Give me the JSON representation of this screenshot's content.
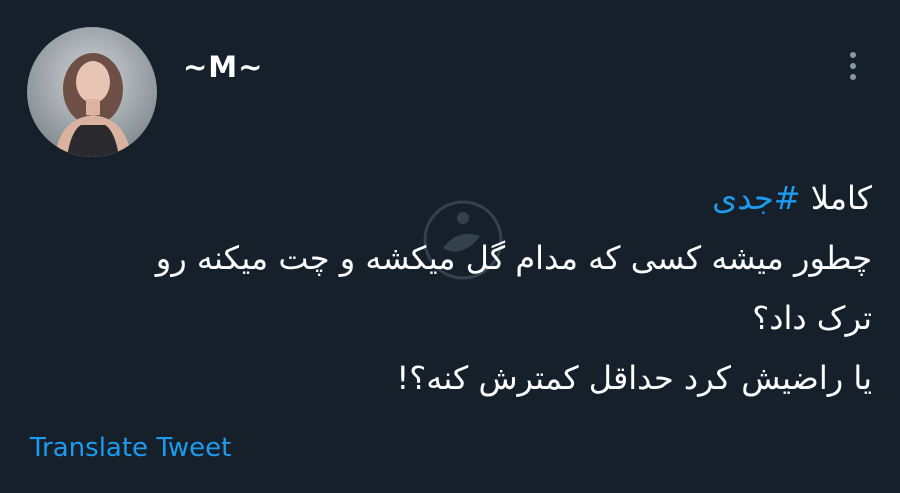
{
  "header": {
    "display_name": "~M~",
    "more_icon": "vertical-ellipsis-icon"
  },
  "tweet": {
    "line1_text": "کاملا ",
    "hashtag": "#جدی",
    "line2": "چطور میشه کسی که مدام گل میکشه و چت میکنه رو",
    "line3": "ترک داد؟",
    "line4": "یا راضیش کرد حداقل کمترش کنه؟!"
  },
  "footer": {
    "translate_label": "Translate Tweet"
  },
  "colors": {
    "background": "#15202b",
    "text": "#ffffff",
    "link": "#1d9bf0",
    "icon": "#8899a6"
  }
}
